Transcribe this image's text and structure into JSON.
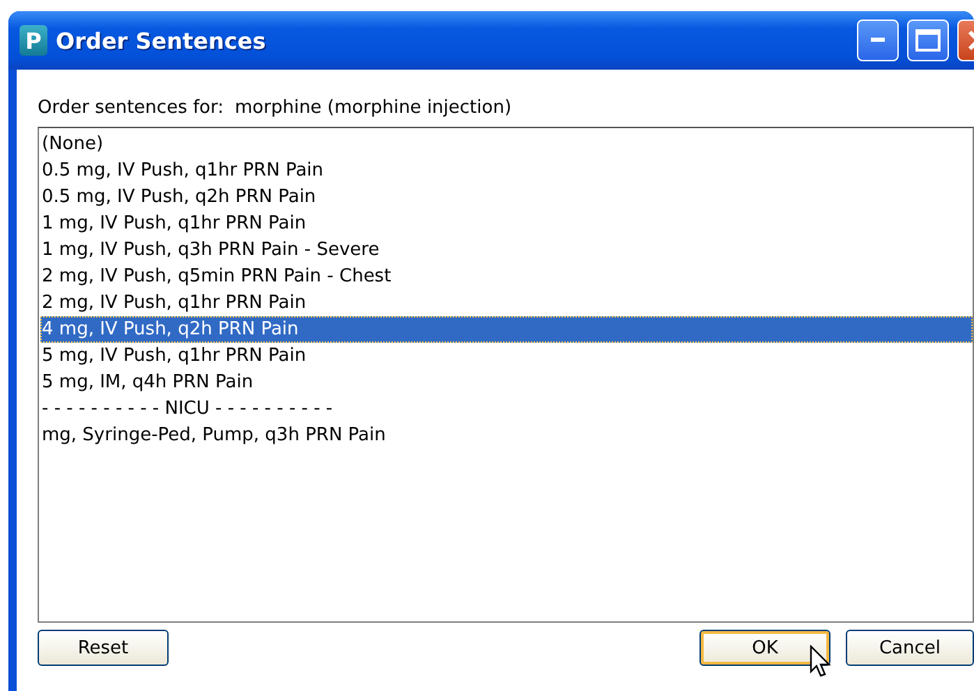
{
  "window": {
    "title": "Order Sentences",
    "app_letter": "P"
  },
  "prompt": {
    "label": "Order sentences for:",
    "value": "morphine (morphine injection)"
  },
  "sentences": [
    {
      "text": "(None)",
      "selected": false
    },
    {
      "text": "0.5 mg, IV Push, q1hr PRN Pain",
      "selected": false
    },
    {
      "text": "0.5 mg, IV Push, q2h PRN Pain",
      "selected": false
    },
    {
      "text": "1 mg, IV Push, q1hr PRN Pain",
      "selected": false
    },
    {
      "text": "1 mg, IV Push, q3h PRN Pain - Severe",
      "selected": false
    },
    {
      "text": "2 mg, IV Push, q5min PRN Pain - Chest",
      "selected": false
    },
    {
      "text": "2 mg, IV Push, q1hr PRN Pain",
      "selected": false
    },
    {
      "text": "4 mg, IV Push, q2h PRN Pain",
      "selected": true
    },
    {
      "text": "5 mg, IV Push, q1hr PRN Pain",
      "selected": false
    },
    {
      "text": "5 mg, IM, q4h PRN Pain",
      "selected": false
    },
    {
      "text": "- - - - - - - - - - NICU - - - - - - - - - -",
      "selected": false
    },
    {
      "text": "mg, Syringe-Ped, Pump, q3h PRN Pain",
      "selected": false
    }
  ],
  "buttons": [
    {
      "label": "Reset",
      "default": false
    },
    {
      "label": "OK",
      "default": true
    },
    {
      "label": "Cancel",
      "default": false
    }
  ]
}
